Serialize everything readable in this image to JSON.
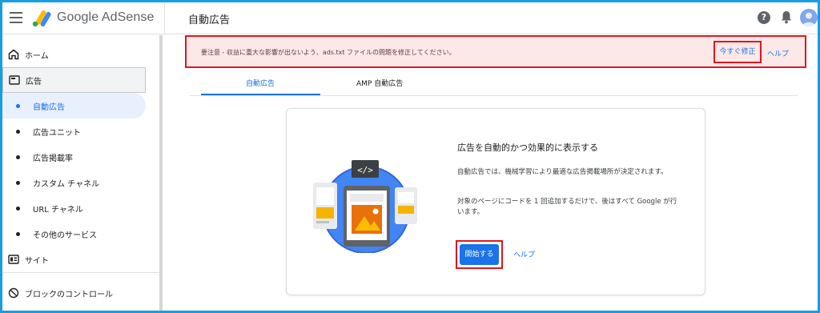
{
  "header": {
    "brand": "Google AdSense",
    "page_title": "自動広告",
    "icons": [
      "menu-icon",
      "adsense-logo",
      "help-icon",
      "bell-icon",
      "account-avatar"
    ]
  },
  "sidebar": {
    "items": [
      {
        "label": "ホーム",
        "icon": "home-icon"
      },
      {
        "label": "広告",
        "icon": "ads-icon"
      },
      {
        "label": "自動広告"
      },
      {
        "label": "広告ユニット"
      },
      {
        "label": "広告掲載率"
      },
      {
        "label": "カスタム チャネル"
      },
      {
        "label": "URL チャネル"
      },
      {
        "label": "その他のサービス"
      },
      {
        "label": "サイト",
        "icon": "sites-icon"
      },
      {
        "label": "ブロックのコントロール",
        "icon": "block-icon"
      }
    ]
  },
  "alert": {
    "text": "要注意 - 収益に重大な影響が出ないよう、ads.txt ファイルの問題を修正してください。",
    "fix_label": "今すぐ修正",
    "help_label": "ヘルプ"
  },
  "tabs": [
    {
      "label": "自動広告",
      "active": true
    },
    {
      "label": "AMP 自動広告",
      "active": false
    }
  ],
  "card": {
    "title": "広告を自動的かつ効果的に表示する",
    "p1": "自動広告では、機械学習により最適な広告掲載場所が決定されます。",
    "p2": "対象のページにコードを 1 回追加するだけで、後はすべて Google が行います。",
    "start_label": "開始する",
    "help_label": "ヘルプ",
    "illustration_code": "</>"
  },
  "colors": {
    "accent": "#1a73e8",
    "highlight_border": "#e0161f",
    "alert_bg": "#fde8e8",
    "frame": "#1a9de0"
  }
}
